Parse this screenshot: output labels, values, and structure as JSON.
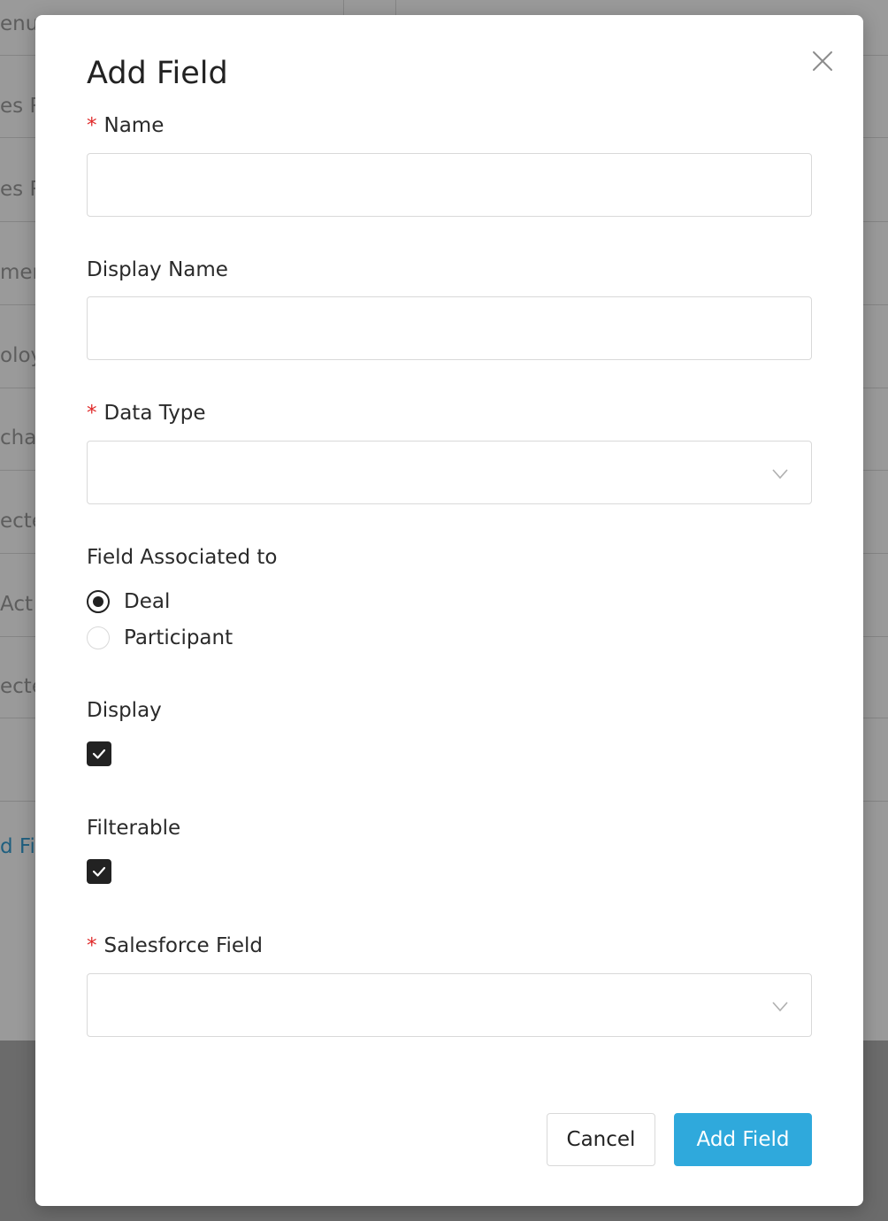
{
  "background": {
    "rows": [
      {
        "text": "enu"
      },
      {
        "text": "es R"
      },
      {
        "text": "es R"
      },
      {
        "text": "mer"
      },
      {
        "text": "oloy"
      },
      {
        "text": "chas"
      },
      {
        "text": "ecte"
      },
      {
        "text": " Act"
      },
      {
        "text": "ecte"
      },
      {
        "text": ""
      }
    ],
    "link_text": "d Fi"
  },
  "modal": {
    "title": "Add Field",
    "close_icon": "close-icon",
    "fields": {
      "name": {
        "label": "Name",
        "required_mark": "*",
        "value": "",
        "placeholder": ""
      },
      "display_name": {
        "label": "Display Name",
        "value": "",
        "placeholder": ""
      },
      "data_type": {
        "label": "Data Type",
        "required_mark": "*",
        "selected": ""
      },
      "field_associated_to": {
        "label": "Field Associated to",
        "options": [
          {
            "label": "Deal",
            "checked": true
          },
          {
            "label": "Participant",
            "checked": false
          }
        ]
      },
      "display": {
        "label": "Display",
        "checked": true
      },
      "filterable": {
        "label": "Filterable",
        "checked": true
      },
      "salesforce_field": {
        "label": "Salesforce Field",
        "required_mark": "*",
        "selected": ""
      }
    },
    "buttons": {
      "cancel": "Cancel",
      "submit": "Add Field"
    }
  },
  "colors": {
    "primary": "#2fa9dc",
    "required": "#e02a2a",
    "overlay": "#9a9a9a"
  }
}
